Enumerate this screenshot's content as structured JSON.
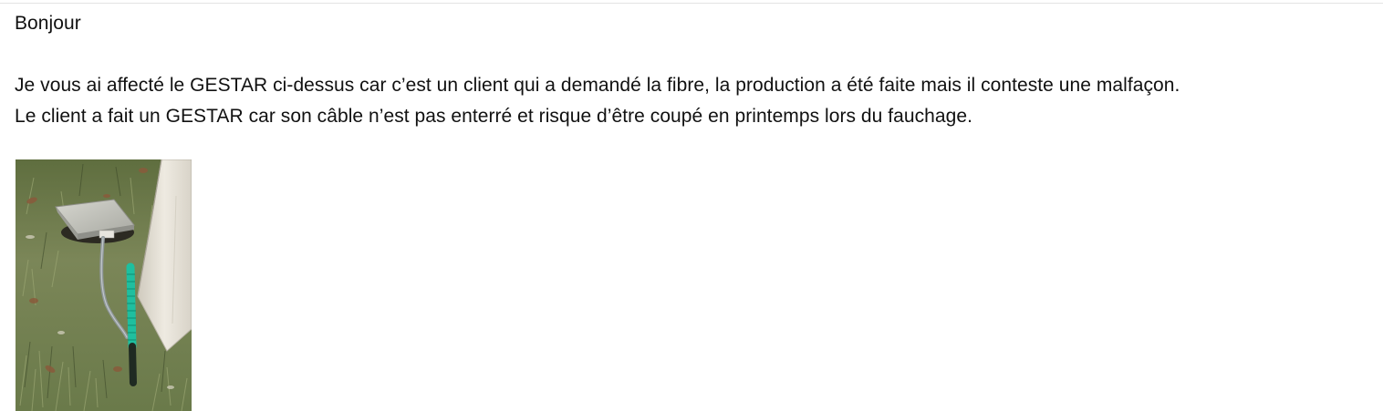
{
  "message": {
    "greeting": "Bonjour",
    "paragraph_line1": "Je vous ai affecté le GESTAR ci-dessus car c’est un client qui a demandé la fibre, la production a été faite mais il conteste une malfaçon.",
    "paragraph_line2": "Le client a fait un GESTAR car son câble n’est pas enterré et risque d’être coupé en printemps lors du fauchage."
  },
  "attachment": {
    "icon": "photo-image",
    "colors": {
      "grass": "#6f7d4f",
      "concrete": "#c9c9c1",
      "cable": "#8f979a",
      "duct": "#1fbf9f"
    }
  }
}
